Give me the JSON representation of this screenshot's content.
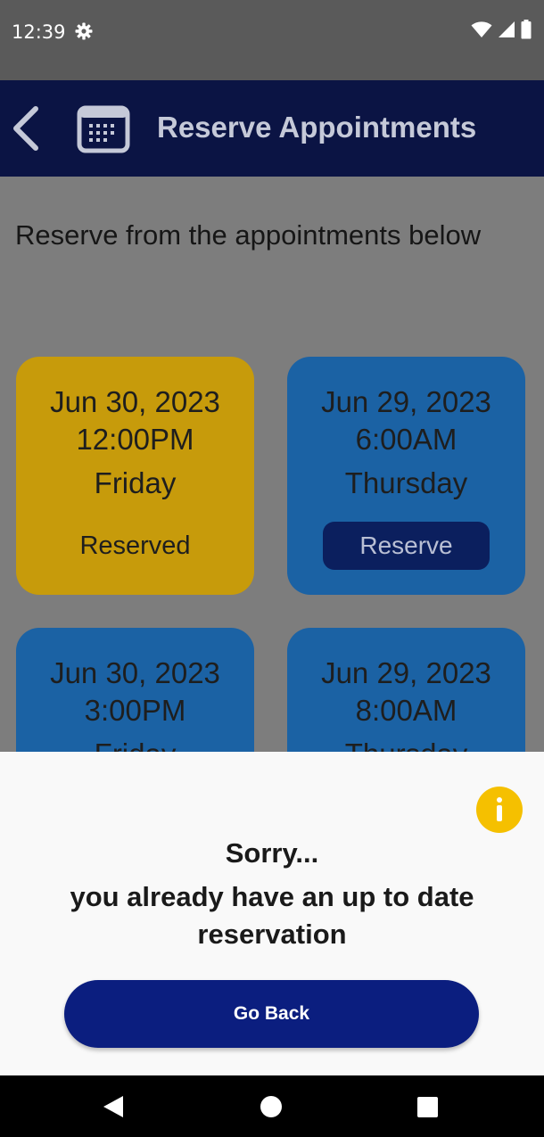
{
  "status_bar": {
    "time": "12:39",
    "icons": [
      "settings-icon",
      "wifi-icon",
      "signal-icon",
      "battery-icon"
    ]
  },
  "app_bar": {
    "title": "Reserve Appointments",
    "back_icon": "chevron-left-icon",
    "calendar_icon": "calendar-icon"
  },
  "main": {
    "subtitle": "Reserve from the appointments below",
    "cards": [
      {
        "date": "Jun 30, 2023",
        "time": "12:00PM",
        "day": "Friday",
        "status": "Reserved"
      },
      {
        "date": "Jun 29, 2023",
        "time": "6:00AM",
        "day": "Thursday",
        "action": "Reserve"
      },
      {
        "date": "Jun 30, 2023",
        "time": "3:00PM",
        "day": "Friday"
      },
      {
        "date": "Jun 29, 2023",
        "time": "8:00AM",
        "day": "Thursday"
      }
    ]
  },
  "dialog": {
    "icon": "info-icon",
    "line1": "Sorry...",
    "line2": "you already have an up to date reservation",
    "button": "Go Back"
  },
  "nav_bar": {
    "icons": [
      "back-triangle-icon",
      "home-circle-icon",
      "recents-square-icon"
    ]
  },
  "colors": {
    "app_bar": "#0b1444",
    "reserved_card": "#c79b0b",
    "available_card": "#1b62a4",
    "reserve_button": "#0b1f5e",
    "go_back_button": "#0b1e7f",
    "info_icon": "#f5c000"
  }
}
